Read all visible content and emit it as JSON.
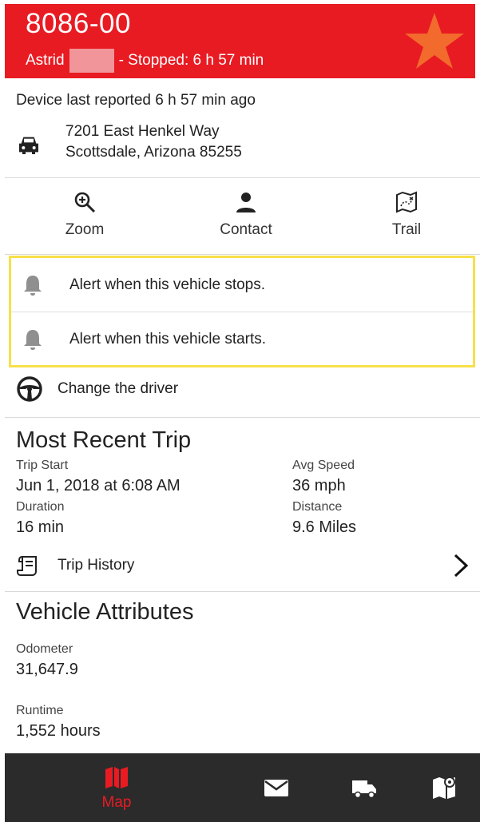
{
  "header": {
    "vehicle_id": "8086-00",
    "driver_first": "Astrid",
    "status": "- Stopped: 6 h 57 min",
    "accent": "#e81b23",
    "star_color": "#f26a2c"
  },
  "device": {
    "last_reported": "Device last reported 6 h 57 min ago",
    "address_line1": "7201 East Henkel Way",
    "address_line2": "Scottsdale, Arizona 85255"
  },
  "actions": {
    "zoom": "Zoom",
    "contact": "Contact",
    "trail": "Trail"
  },
  "alerts": {
    "stop_label": "Alert when this vehicle stops.",
    "start_label": "Alert when this vehicle starts.",
    "highlight_color": "#f7e04a"
  },
  "driver": {
    "change_label": "Change the driver"
  },
  "trip": {
    "title": "Most Recent Trip",
    "start_label": "Trip Start",
    "start_value": "Jun 1, 2018 at 6:08 AM",
    "duration_label": "Duration",
    "duration_value": "16 min",
    "avg_speed_label": "Avg Speed",
    "avg_speed_value": "36 mph",
    "distance_label": "Distance",
    "distance_value": "9.6 Miles",
    "history_label": "Trip History"
  },
  "attributes": {
    "title": "Vehicle Attributes",
    "odometer_label": "Odometer",
    "odometer_value": "31,647.9",
    "runtime_label": "Runtime",
    "runtime_value": "1,552 hours"
  },
  "nav": {
    "map_label": "Map",
    "icons": [
      "map-icon",
      "mail-icon",
      "truck-icon",
      "map-pin-icon"
    ]
  }
}
